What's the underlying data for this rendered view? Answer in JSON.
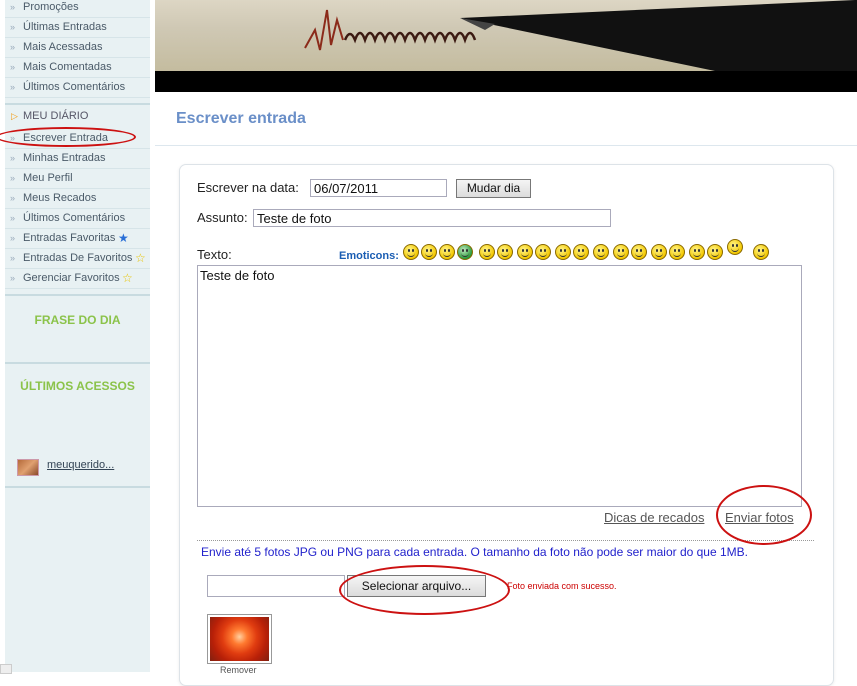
{
  "sidebar": {
    "items_top": [
      {
        "label": "Promoções"
      },
      {
        "label": "Últimas Entradas"
      },
      {
        "label": "Mais Acessadas"
      },
      {
        "label": "Mais Comentadas"
      },
      {
        "label": "Últimos Comentários"
      }
    ],
    "diary_heading": "MEU DIÁRIO",
    "items_diary": [
      {
        "label": "Escrever Entrada"
      },
      {
        "label": "Minhas Entradas"
      },
      {
        "label": "Meu Perfil"
      },
      {
        "label": "Meus Recados"
      },
      {
        "label": "Últimos Comentários"
      },
      {
        "label": "Entradas Favoritas"
      },
      {
        "label": "Entradas De Favoritos"
      },
      {
        "label": "Gerenciar Favoritos"
      }
    ],
    "phrase_title": "FRASE DO DIA",
    "last_access_title": "ÚLTIMOS ACESSOS",
    "last_visitor": "meuquerido..."
  },
  "main": {
    "page_title": "Escrever entrada",
    "date_label": "Escrever na data:",
    "date_value": "06/07/2011",
    "change_day_button": "Mudar dia",
    "subject_label": "Assunto:",
    "subject_value": "Teste de foto",
    "text_label": "Texto:",
    "emoticons_label": "Emoticons:",
    "text_value": "Teste de foto",
    "tips_link": "Dicas de recados",
    "send_photos_link": "Enviar fotos",
    "info_text": "Envie até 5 fotos JPG ou PNG para cada entrada. O tamanho da foto não pode ser maior do que 1MB.",
    "select_file_button": "Selecionar arquivo...",
    "upload_success": "Foto enviada com sucesso.",
    "remove_label": "Remover"
  },
  "colors": {
    "accent_title": "#6a8fc8",
    "info_blue": "#2222cc",
    "success_red": "#cc0000",
    "highlight_ring": "#cc1111",
    "box_title_green": "#8bc34a"
  }
}
